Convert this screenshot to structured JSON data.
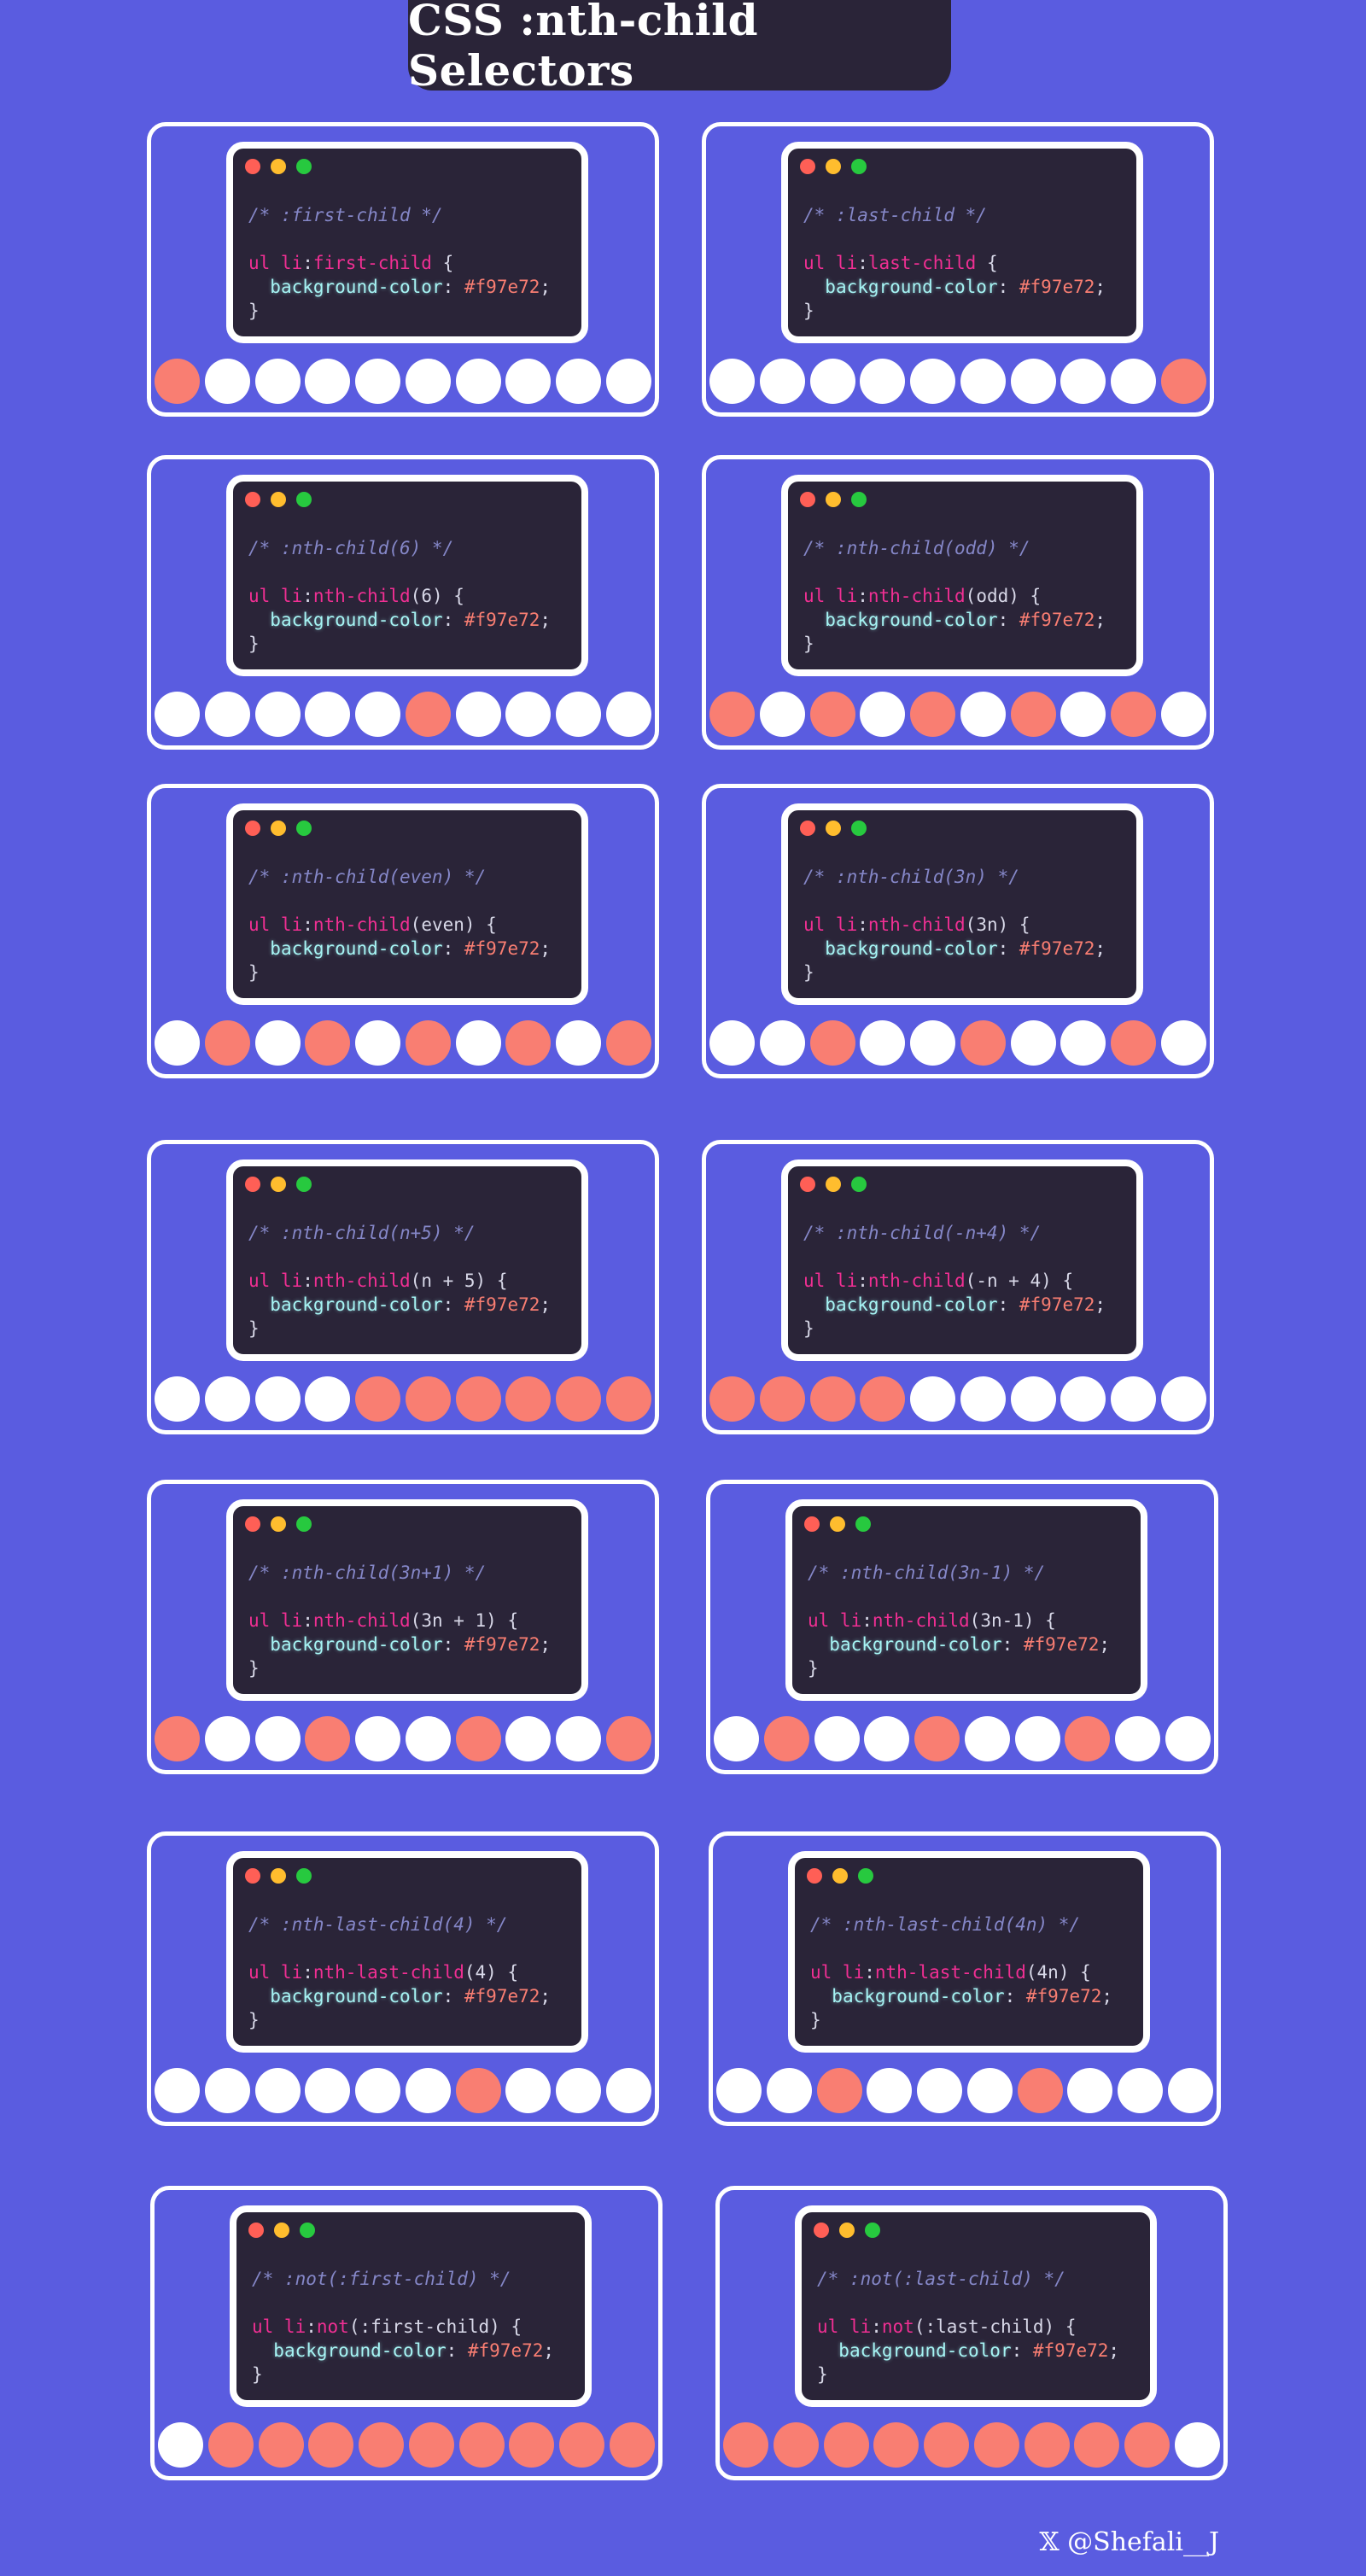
{
  "title": "CSS :nth-child Selectors",
  "credit": "𝕏 @Shefali__J",
  "colors": {
    "background": "#5a5ce0",
    "editor": "#2a2438",
    "highlight": "#f97e72",
    "default": "#ffffff"
  },
  "cards": [
    {
      "comment": "/* :first-child */",
      "tag": "ul li",
      "colon": ":",
      "pseudo": "first-child",
      "brace": " {",
      "prop": "background-color",
      "value": "#f97e72",
      "close": "}",
      "highlighted": [
        1
      ]
    },
    {
      "comment": "/* :last-child */",
      "tag": "ul li",
      "colon": ":",
      "pseudo": "last-child",
      "brace": " {",
      "prop": "background-color",
      "value": "#f97e72",
      "close": "}",
      "highlighted": [
        10
      ]
    },
    {
      "comment": "/* :nth-child(6) */",
      "tag": "ul li",
      "colon": ":",
      "pseudo": "nth-child",
      "args": "(6)",
      "brace": " {",
      "prop": "background-color",
      "value": "#f97e72",
      "close": "}",
      "highlighted": [
        6
      ]
    },
    {
      "comment": "/* :nth-child(odd) */",
      "tag": "ul li",
      "colon": ":",
      "pseudo": "nth-child",
      "args": "(odd)",
      "brace": " {",
      "prop": "background-color",
      "value": "#f97e72",
      "close": "}",
      "highlighted": [
        1,
        3,
        5,
        7,
        9
      ]
    },
    {
      "comment": "/* :nth-child(even) */",
      "tag": "ul li",
      "colon": ":",
      "pseudo": "nth-child",
      "args": "(even)",
      "brace": " {",
      "prop": "background-color",
      "value": "#f97e72",
      "close": "}",
      "highlighted": [
        2,
        4,
        6,
        8,
        10
      ]
    },
    {
      "comment": "/* :nth-child(3n) */",
      "tag": "ul li",
      "colon": ":",
      "pseudo": "nth-child",
      "args": "(3n)",
      "brace": " {",
      "prop": "background-color",
      "value": "#f97e72",
      "close": "}",
      "highlighted": [
        3,
        6,
        9
      ]
    },
    {
      "comment": "/* :nth-child(n+5) */",
      "tag": "ul li",
      "colon": ":",
      "pseudo": "nth-child",
      "args": "(n + 5)",
      "brace": " {",
      "prop": "background-color",
      "value": "#f97e72",
      "close": "}",
      "highlighted": [
        5,
        6,
        7,
        8,
        9,
        10
      ]
    },
    {
      "comment": "/* :nth-child(-n+4) */",
      "tag": "ul li",
      "colon": ":",
      "pseudo": "nth-child",
      "args": "(-n + 4)",
      "brace": " {",
      "prop": "background-color",
      "value": "#f97e72",
      "close": "}",
      "highlighted": [
        1,
        2,
        3,
        4
      ]
    },
    {
      "comment": "/* :nth-child(3n+1) */",
      "tag": "ul li",
      "colon": ":",
      "pseudo": "nth-child",
      "args": "(3n + 1)",
      "brace": " {",
      "prop": "background-color",
      "value": "#f97e72",
      "close": "}",
      "highlighted": [
        1,
        4,
        7,
        10
      ]
    },
    {
      "comment": "/* :nth-child(3n-1) */",
      "tag": "ul li",
      "colon": ":",
      "pseudo": "nth-child",
      "args": "(3n-1)",
      "brace": " {",
      "prop": "background-color",
      "value": "#f97e72",
      "close": "}",
      "highlighted": [
        2,
        5,
        8
      ]
    },
    {
      "comment": "/* :nth-last-child(4) */",
      "tag": "ul li",
      "colon": ":",
      "pseudo": "nth-last-child",
      "args": "(4)",
      "brace": " {",
      "prop": "background-color",
      "value": "#f97e72",
      "close": "}",
      "highlighted": [
        7
      ]
    },
    {
      "comment": "/* :nth-last-child(4n) */",
      "tag": "ul li",
      "colon": ":",
      "pseudo": "nth-last-child",
      "args": "(4n)",
      "brace": " {",
      "prop": "background-color",
      "value": "#f97e72",
      "close": "}",
      "highlighted": [
        3,
        7
      ]
    },
    {
      "comment": "/* :not(:first-child) */",
      "tag": "ul li",
      "colon": ":",
      "pseudo": "not",
      "args": "(:first-child)",
      "brace": " {",
      "prop": "background-color",
      "value": "#f97e72",
      "close": "}",
      "highlighted": [
        2,
        3,
        4,
        5,
        6,
        7,
        8,
        9,
        10
      ]
    },
    {
      "comment": "/* :not(:last-child) */",
      "tag": "ul li",
      "colon": ":",
      "pseudo": "not",
      "args": "(:last-child)",
      "brace": " {",
      "prop": "background-color",
      "value": "#f97e72",
      "close": "}",
      "highlighted": [
        1,
        2,
        3,
        4,
        5,
        6,
        7,
        8,
        9
      ]
    }
  ]
}
